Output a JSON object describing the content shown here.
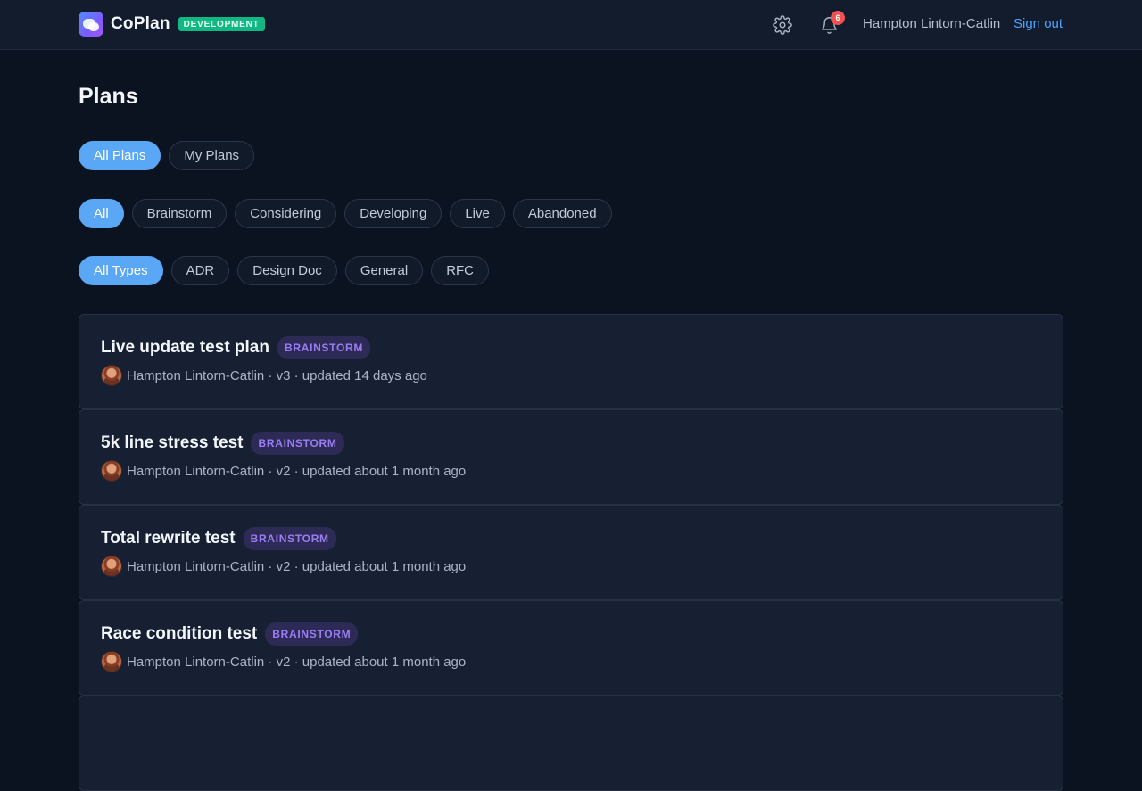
{
  "header": {
    "app_name": "CoPlan",
    "env_badge": "DEVELOPMENT",
    "notification_count": "6",
    "user_name": "Hampton Lintorn-Catlin",
    "sign_out_label": "Sign out",
    "icons": {
      "logo": "coplan-logo-icon",
      "settings": "gear-icon",
      "notifications": "bell-icon"
    }
  },
  "page": {
    "title": "Plans"
  },
  "filters": {
    "scope": [
      {
        "label": "All Plans",
        "active": true
      },
      {
        "label": "My Plans",
        "active": false
      }
    ],
    "status": [
      {
        "label": "All",
        "active": true
      },
      {
        "label": "Brainstorm",
        "active": false
      },
      {
        "label": "Considering",
        "active": false
      },
      {
        "label": "Developing",
        "active": false
      },
      {
        "label": "Live",
        "active": false
      },
      {
        "label": "Abandoned",
        "active": false
      }
    ],
    "type": [
      {
        "label": "All Types",
        "active": true
      },
      {
        "label": "ADR",
        "active": false
      },
      {
        "label": "Design Doc",
        "active": false
      },
      {
        "label": "General",
        "active": false
      },
      {
        "label": "RFC",
        "active": false
      }
    ]
  },
  "plans": [
    {
      "title": "Live update test plan",
      "status": "BRAINSTORM",
      "author": "Hampton Lintorn-Catlin",
      "meta": "· v3 · updated 14 days ago"
    },
    {
      "title": "5k line stress test",
      "status": "BRAINSTORM",
      "author": "Hampton Lintorn-Catlin",
      "meta": "· v2 · updated about 1 month ago"
    },
    {
      "title": "Total rewrite test",
      "status": "BRAINSTORM",
      "author": "Hampton Lintorn-Catlin",
      "meta": "· v2 · updated about 1 month ago"
    },
    {
      "title": "Race condition test",
      "status": "BRAINSTORM",
      "author": "Hampton Lintorn-Catlin",
      "meta": "· v2 · updated about 1 month ago"
    }
  ],
  "colors": {
    "background": "#0b1220",
    "accent": "#5aa7f5",
    "link": "#4ea3ff",
    "env_badge": "#10b981",
    "brainstorm_tag_bg": "#2d2a56",
    "brainstorm_tag_text": "#9a7df4",
    "notification_badge": "#f05252"
  }
}
